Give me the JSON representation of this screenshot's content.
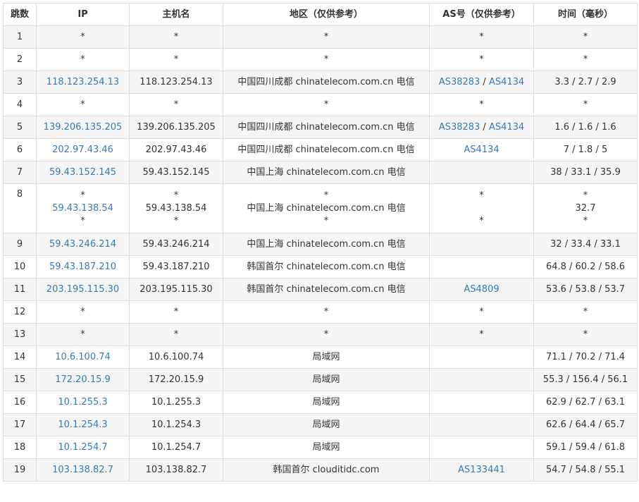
{
  "headers": {
    "hop": "跳数",
    "ip": "IP",
    "host": "主机名",
    "region": "地区（仅供参考）",
    "as": "AS号（仅供参考）",
    "time": "时间（毫秒）"
  },
  "as_separator": " / ",
  "rows": [
    {
      "hop": "1",
      "ip": "*",
      "ip_link": false,
      "host": "*",
      "region": "*",
      "as": [],
      "as_text": "*",
      "time": "*"
    },
    {
      "hop": "2",
      "ip": "*",
      "ip_link": false,
      "host": "*",
      "region": "*",
      "as": [],
      "as_text": "*",
      "time": "*"
    },
    {
      "hop": "3",
      "ip": "118.123.254.13",
      "ip_link": true,
      "host": "118.123.254.13",
      "region": "中国四川成都 chinatelecom.com.cn 电信",
      "as": [
        "AS38283",
        "AS4134"
      ],
      "as_text": "",
      "time": "3.3 / 2.7 / 2.9"
    },
    {
      "hop": "4",
      "ip": "*",
      "ip_link": false,
      "host": "*",
      "region": "*",
      "as": [],
      "as_text": "*",
      "time": "*"
    },
    {
      "hop": "5",
      "ip": "139.206.135.205",
      "ip_link": true,
      "host": "139.206.135.205",
      "region": "中国四川成都 chinatelecom.com.cn 电信",
      "as": [
        "AS38283",
        "AS4134"
      ],
      "as_text": "",
      "time": "1.6 / 1.6 / 1.6"
    },
    {
      "hop": "6",
      "ip": "202.97.43.46",
      "ip_link": true,
      "host": "202.97.43.46",
      "region": "中国四川成都 chinatelecom.com.cn 电信",
      "as": [
        "AS4134"
      ],
      "as_text": "",
      "time": "7 / 1.8 / 5"
    },
    {
      "hop": "7",
      "ip": "59.43.152.145",
      "ip_link": true,
      "host": "59.43.152.145",
      "region": "中国上海 chinatelecom.com.cn 电信",
      "as": [],
      "as_text": "",
      "time": "38 / 33.1 / 35.9"
    },
    {
      "hop": "8",
      "multi": true,
      "lines": [
        {
          "ip": "*",
          "ip_link": false,
          "host": "*",
          "region": "*",
          "as": "*",
          "time": "*"
        },
        {
          "ip": "59.43.138.54",
          "ip_link": true,
          "host": "59.43.138.54",
          "region": "中国上海 chinatelecom.com.cn 电信",
          "as": "",
          "time": "32.7"
        },
        {
          "ip": "*",
          "ip_link": false,
          "host": "*",
          "region": "*",
          "as": "*",
          "time": "*"
        }
      ]
    },
    {
      "hop": "9",
      "ip": "59.43.246.214",
      "ip_link": true,
      "host": "59.43.246.214",
      "region": "中国上海 chinatelecom.com.cn 电信",
      "as": [],
      "as_text": "",
      "time": "32 / 33.4 / 33.1"
    },
    {
      "hop": "10",
      "ip": "59.43.187.210",
      "ip_link": true,
      "host": "59.43.187.210",
      "region": "韩国首尔 chinatelecom.com.cn 电信",
      "as": [],
      "as_text": "",
      "time": "64.8 / 60.2 / 58.6"
    },
    {
      "hop": "11",
      "ip": "203.195.115.30",
      "ip_link": true,
      "host": "203.195.115.30",
      "region": "韩国首尔 chinatelecom.com.cn 电信",
      "as": [
        "AS4809"
      ],
      "as_text": "",
      "time": "53.6 / 53.8 / 53.7"
    },
    {
      "hop": "12",
      "ip": "*",
      "ip_link": false,
      "host": "*",
      "region": "*",
      "as": [],
      "as_text": "*",
      "time": "*"
    },
    {
      "hop": "13",
      "ip": "*",
      "ip_link": false,
      "host": "*",
      "region": "*",
      "as": [],
      "as_text": "*",
      "time": "*"
    },
    {
      "hop": "14",
      "ip": "10.6.100.74",
      "ip_link": true,
      "host": "10.6.100.74",
      "region": "局域网",
      "as": [],
      "as_text": "",
      "time": "71.1 / 70.2 / 71.4"
    },
    {
      "hop": "15",
      "ip": "172.20.15.9",
      "ip_link": true,
      "host": "172.20.15.9",
      "region": "局域网",
      "as": [],
      "as_text": "",
      "time": "55.3 / 156.4 / 56.1"
    },
    {
      "hop": "16",
      "ip": "10.1.255.3",
      "ip_link": true,
      "host": "10.1.255.3",
      "region": "局域网",
      "as": [],
      "as_text": "",
      "time": "62.9 / 62.7 / 63.1"
    },
    {
      "hop": "17",
      "ip": "10.1.254.3",
      "ip_link": true,
      "host": "10.1.254.3",
      "region": "局域网",
      "as": [],
      "as_text": "",
      "time": "62.6 / 64.4 / 65.7"
    },
    {
      "hop": "18",
      "ip": "10.1.254.7",
      "ip_link": true,
      "host": "10.1.254.7",
      "region": "局域网",
      "as": [],
      "as_text": "",
      "time": "59.1 / 59.4 / 61.8"
    },
    {
      "hop": "19",
      "ip": "103.138.82.7",
      "ip_link": true,
      "host": "103.138.82.7",
      "region": "韩国首尔 clouditidc.com",
      "as": [
        "AS133441"
      ],
      "as_text": "",
      "time": "54.7 / 54.8 / 55.1"
    }
  ]
}
